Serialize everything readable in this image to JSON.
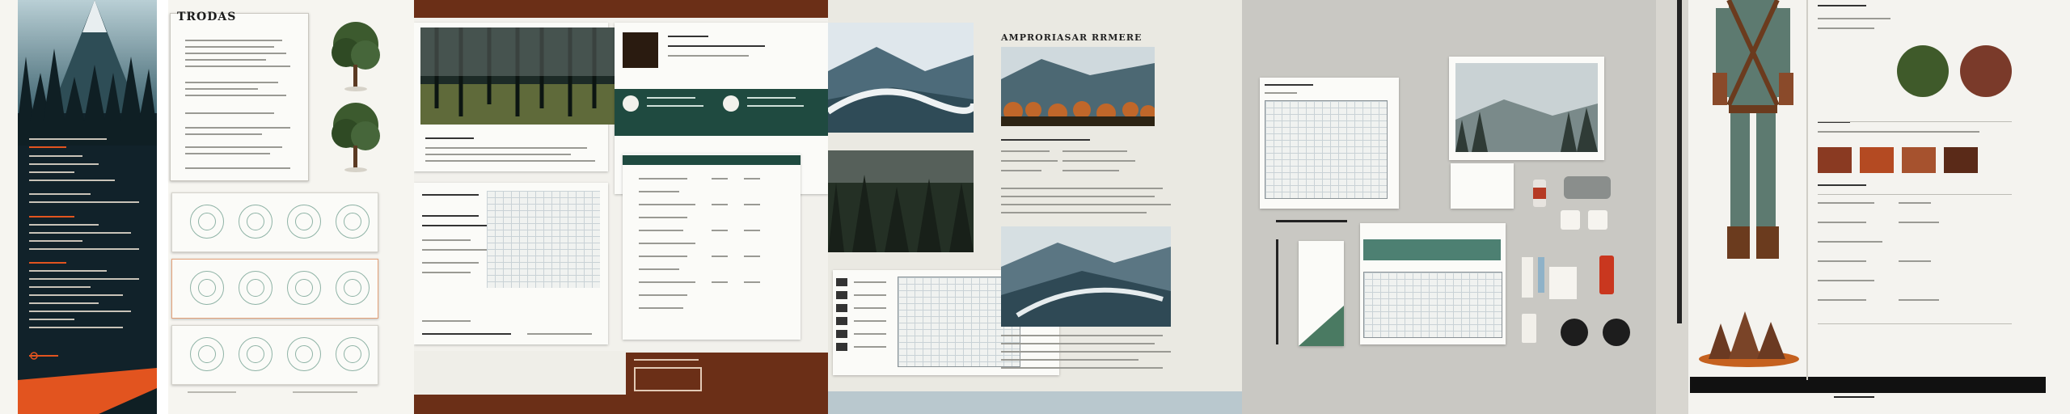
{
  "panel1": {
    "heading": "TRODAS"
  },
  "panel2": {},
  "panel3": {
    "heading": "AMPRORIASAR RRMERE"
  },
  "panel4": {},
  "panel5": {},
  "colors": {
    "forest_dark": "#12232a",
    "orange": "#e2541f",
    "brown": "#6b2f17",
    "teal_dark": "#1f4a40",
    "uniform_green": "#5d7a70"
  }
}
